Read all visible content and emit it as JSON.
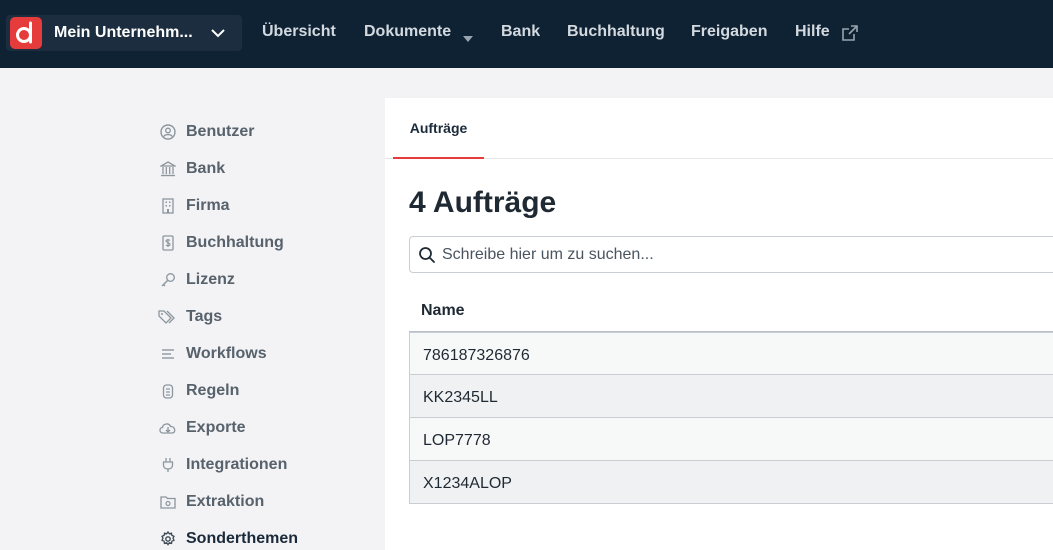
{
  "header": {
    "company_name": "Mein Unternehm...",
    "nav": {
      "overview": "Übersicht",
      "documents": "Dokumente",
      "bank": "Bank",
      "accounting": "Buchhaltung",
      "approvals": "Freigaben",
      "help": "Hilfe"
    }
  },
  "sidebar": {
    "items": [
      {
        "label": "Benutzer",
        "icon": "user-circle-icon"
      },
      {
        "label": "Bank",
        "icon": "bank-icon"
      },
      {
        "label": "Firma",
        "icon": "building-icon"
      },
      {
        "label": "Buchhaltung",
        "icon": "calculator-icon"
      },
      {
        "label": "Lizenz",
        "icon": "key-icon"
      },
      {
        "label": "Tags",
        "icon": "tags-icon"
      },
      {
        "label": "Workflows",
        "icon": "list-icon"
      },
      {
        "label": "Regeln",
        "icon": "rules-icon"
      },
      {
        "label": "Exporte",
        "icon": "cloud-download-icon"
      },
      {
        "label": "Integrationen",
        "icon": "plug-icon"
      },
      {
        "label": "Extraktion",
        "icon": "folder-icon"
      },
      {
        "label": "Sonderthemen",
        "icon": "gear-icon"
      }
    ],
    "active": "Sonderthemen"
  },
  "main": {
    "tab_label": "Aufträge",
    "title": "4 Aufträge",
    "search_placeholder": "Schreibe hier um zu suchen...",
    "column_header": "Name",
    "rows": [
      "786187326876",
      "KK2345LL",
      "LOP7778",
      "X1234ALOP"
    ]
  },
  "colors": {
    "brand": "#e63b3b",
    "topbar": "#0f2234"
  }
}
